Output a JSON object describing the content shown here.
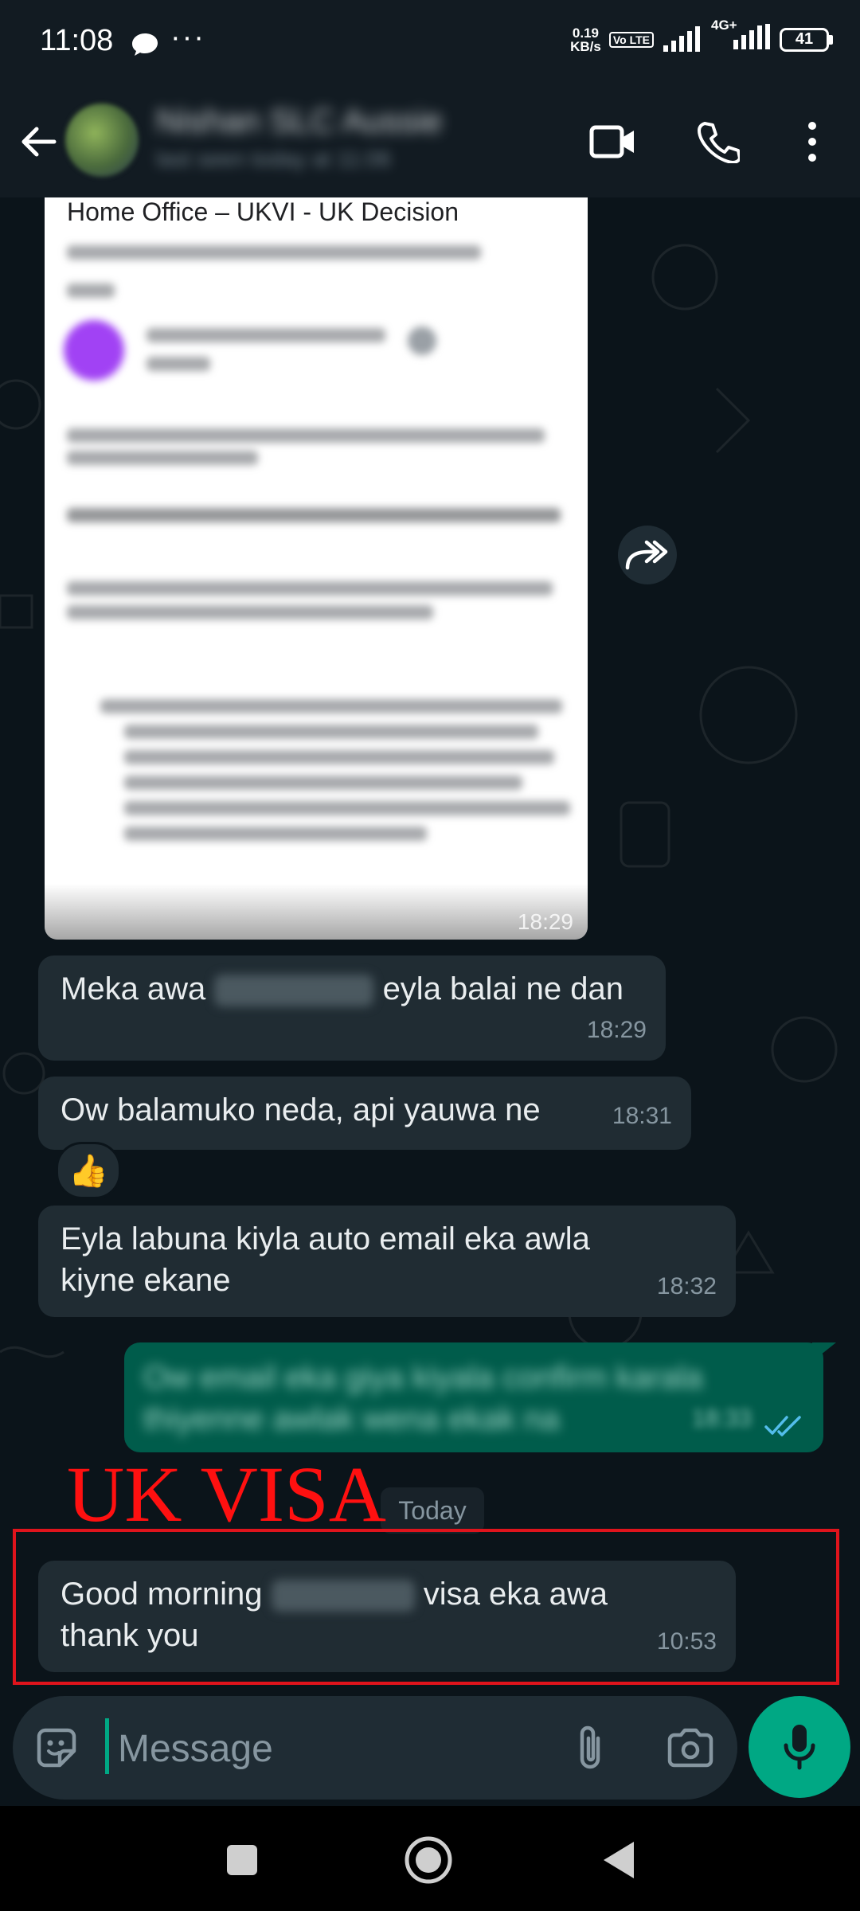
{
  "status_bar": {
    "time": "11:08",
    "dots": "···",
    "speed_value": "0.19",
    "speed_unit": "KB/s",
    "volte": "Vo LTE",
    "network": "4G+",
    "battery": "41"
  },
  "header": {
    "contact_name": "Nishan SLC Aussie",
    "contact_status": "last seen today at 11:06"
  },
  "messages": {
    "image_caption_title": "Home Office – UKVI  - UK Decision",
    "image_time": "18:29",
    "msg1": {
      "before": "Meka awa",
      "after": "eyla balai ne dan",
      "time": "18:29"
    },
    "msg2": {
      "text": "Ow balamuko neda, api yauwa ne",
      "time": "18:31",
      "reaction": "👍"
    },
    "msg3": {
      "text": "Eyla labuna kiyla auto email eka awla kiyne ekane",
      "time": "18:32"
    },
    "msg4": {
      "line1": "Ow email eka giya kiyala confirm karala",
      "line2": "thiyenne awlak wena ekak na",
      "time": "18:33"
    },
    "date_chip": "Today",
    "msg5": {
      "before": "Good morning",
      "after": "visa eka awa thank you",
      "time": "10:53"
    }
  },
  "annotation": {
    "text": "UK VISA",
    "color": "#ff1010"
  },
  "composer": {
    "placeholder": "Message"
  },
  "colors": {
    "accent": "#00a884",
    "incoming_bubble": "#202c33",
    "outgoing_bubble": "#005c4b",
    "background": "#0b141a"
  }
}
